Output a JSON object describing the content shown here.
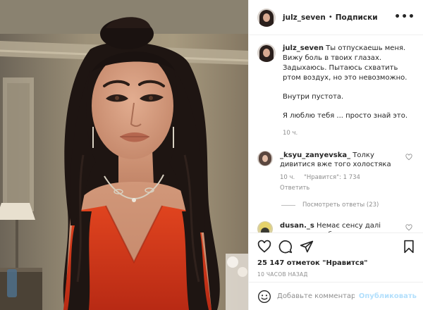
{
  "post": {
    "author": "julz_seven",
    "follow_label": "Подписки",
    "separator": "•",
    "more_label": "•••"
  },
  "caption": {
    "user": "julz_seven",
    "line1": "Ты отпускаешь меня. Вижу боль в твоих глазах. Задыхаюсь. Пытаюсь схватить ртом воздух, но это невозможно.",
    "line2": "Внутри пустота.",
    "line3": "Я люблю тебя ... просто знай это.",
    "time": "10 ч."
  },
  "comments": [
    {
      "user": "_ksyu_zanyevska_",
      "text": "Толку дивитися вже того холостяка",
      "time": "10 ч.",
      "likes": "\"Нравится\": 1 734",
      "reply_label": "Ответить",
      "view_replies": "Посмотреть ответы (23)"
    },
    {
      "user": "dusan._s",
      "text": "Немає сенсу далі дивитися як буде моєю"
    }
  ],
  "actions": {
    "likes_text": "25 147 отметок \"Нравится\"",
    "posted_time": "10 ЧАСОВ НАЗАД"
  },
  "add_comment": {
    "placeholder": "Добавьте комментарий...",
    "publish_label": "Опубликовать"
  },
  "icons": {
    "like": "heart-icon",
    "comment": "comment-icon",
    "share": "paper-plane-icon",
    "save": "bookmark-icon",
    "emoji": "emoji-icon",
    "more": "more-icon"
  },
  "colors": {
    "dress": "#d9381e",
    "hair": "#1e1512",
    "skin": "#d49a7c",
    "publish_disabled": "#b2dffc",
    "secondary_text": "#8e8e8e"
  }
}
